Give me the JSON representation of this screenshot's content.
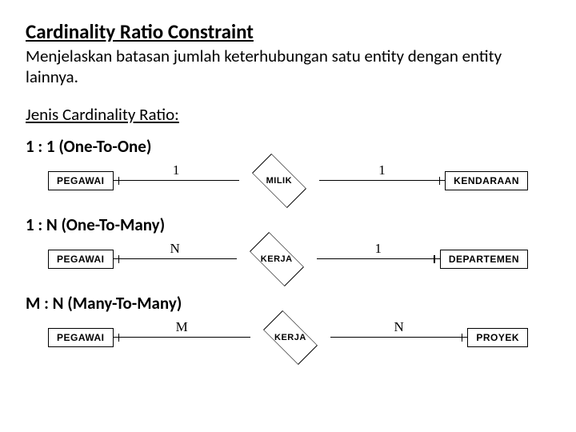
{
  "title": "Cardinality Ratio Constraint",
  "description": "Menjelaskan batasan jumlah keterhubungan satu entity dengan entity lainnya.",
  "subheading": "Jenis Cardinality Ratio:",
  "ratios": {
    "one_one": {
      "label": "1 : 1 (One-To-One)",
      "left_entity": "PEGAWAI",
      "left_card": "1",
      "relationship": "MILIK",
      "right_card": "1",
      "right_entity": "KENDARAAN"
    },
    "one_many": {
      "label": "1 : N (One-To-Many)",
      "left_entity": "PEGAWAI",
      "left_card": "N",
      "relationship": "KERJA",
      "right_card": "1",
      "right_entity": "DEPARTEMEN"
    },
    "many_many": {
      "label": "M : N (Many-To-Many)",
      "left_entity": "PEGAWAI",
      "left_card": "M",
      "relationship": "KERJA",
      "right_card": "N",
      "right_entity": "PROYEK"
    }
  }
}
